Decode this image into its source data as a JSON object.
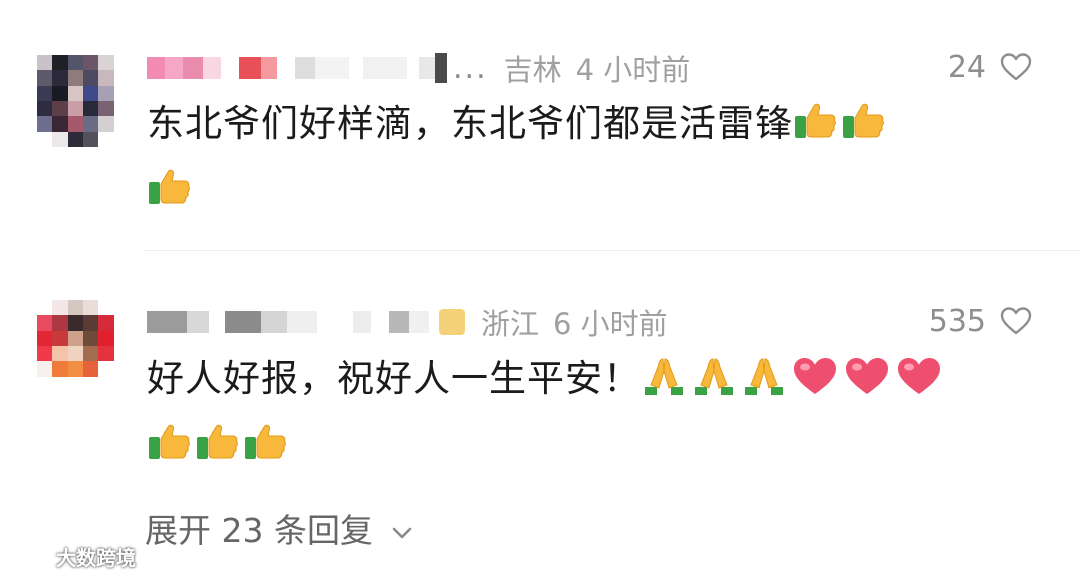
{
  "comments": [
    {
      "location": "吉林",
      "time": "4 小时前",
      "likes": "24",
      "ellipsis": "...",
      "text": "东北爷们好样滴，东北爷们都是活雷锋",
      "emojis_after_text": [
        "thumbs-up",
        "thumbs-up",
        "thumbs-up"
      ]
    },
    {
      "location": "浙江",
      "time": "6 小时前",
      "likes": "535",
      "text": "好人好报，祝好人一生平安！",
      "emojis_after_text": [
        "folded-hands",
        "folded-hands",
        "folded-hands",
        "red-heart",
        "red-heart",
        "red-heart",
        "thumbs-up",
        "thumbs-up",
        "thumbs-up"
      ]
    }
  ],
  "expand_replies": "展开 23 条回复",
  "watermark": "大数跨境",
  "icons": {
    "like": "heart-outline-icon",
    "expand": "chevron-down-icon"
  },
  "colors": {
    "meta_text": "#a0a0a0",
    "body_text": "#1b1b1b",
    "expand_text": "#666666"
  }
}
